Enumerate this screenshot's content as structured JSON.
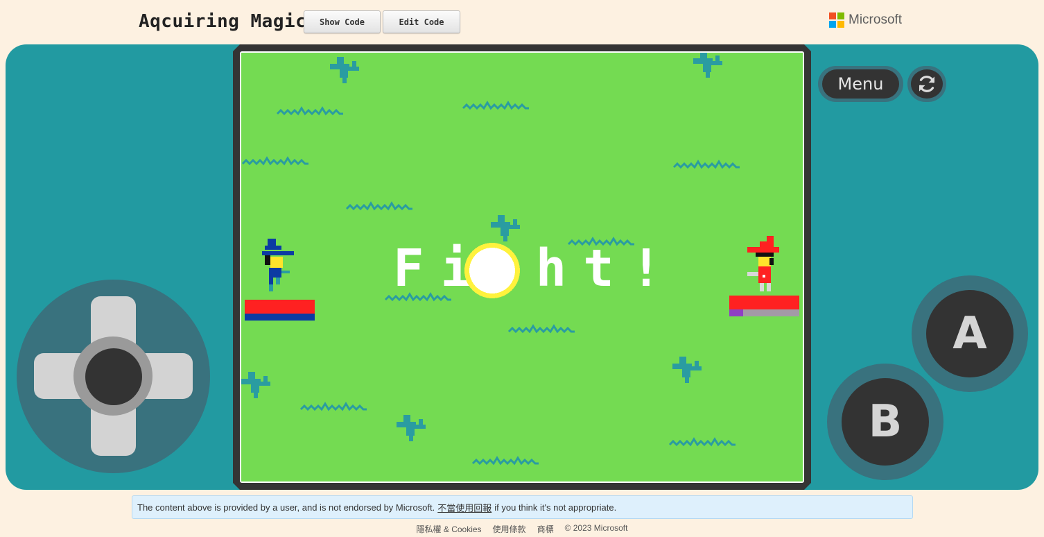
{
  "header": {
    "title": "Aqcuiring Magic",
    "show_code_label": "Show Code",
    "edit_code_label": "Edit Code",
    "brand_name": "Microsoft",
    "logo_colors": [
      "#f25022",
      "#7fba00",
      "#00a4ef",
      "#ffb900"
    ]
  },
  "controls": {
    "menu_label": "Menu",
    "reset_icon": "refresh-icon",
    "a_label": "A",
    "b_label": "B"
  },
  "game": {
    "banner_text": "Fi ht!",
    "player_hp": 1.0,
    "player_mana": 1.0,
    "enemy_hp": 1.0,
    "enemy_mana": 0.2,
    "colors": {
      "grass": "#74db52",
      "foliage": "#2a9ca1",
      "hp": "#ff2121",
      "player_mana": "#0c3ba3",
      "enemy_mana": "#8f3fc5",
      "enemy_mana_empty": "#a39aa6",
      "console": "#229aa1",
      "button_ring": "#39727e"
    }
  },
  "footer": {
    "notice_text": "The content above is provided by a user, and is not endorsed by Microsoft.",
    "report_link": "不當使用回報",
    "notice_suffix": "if you think it's not appropriate.",
    "links": [
      "隱私權 & Cookies",
      "使用條款",
      "商標"
    ],
    "copyright": "© 2023 Microsoft"
  }
}
